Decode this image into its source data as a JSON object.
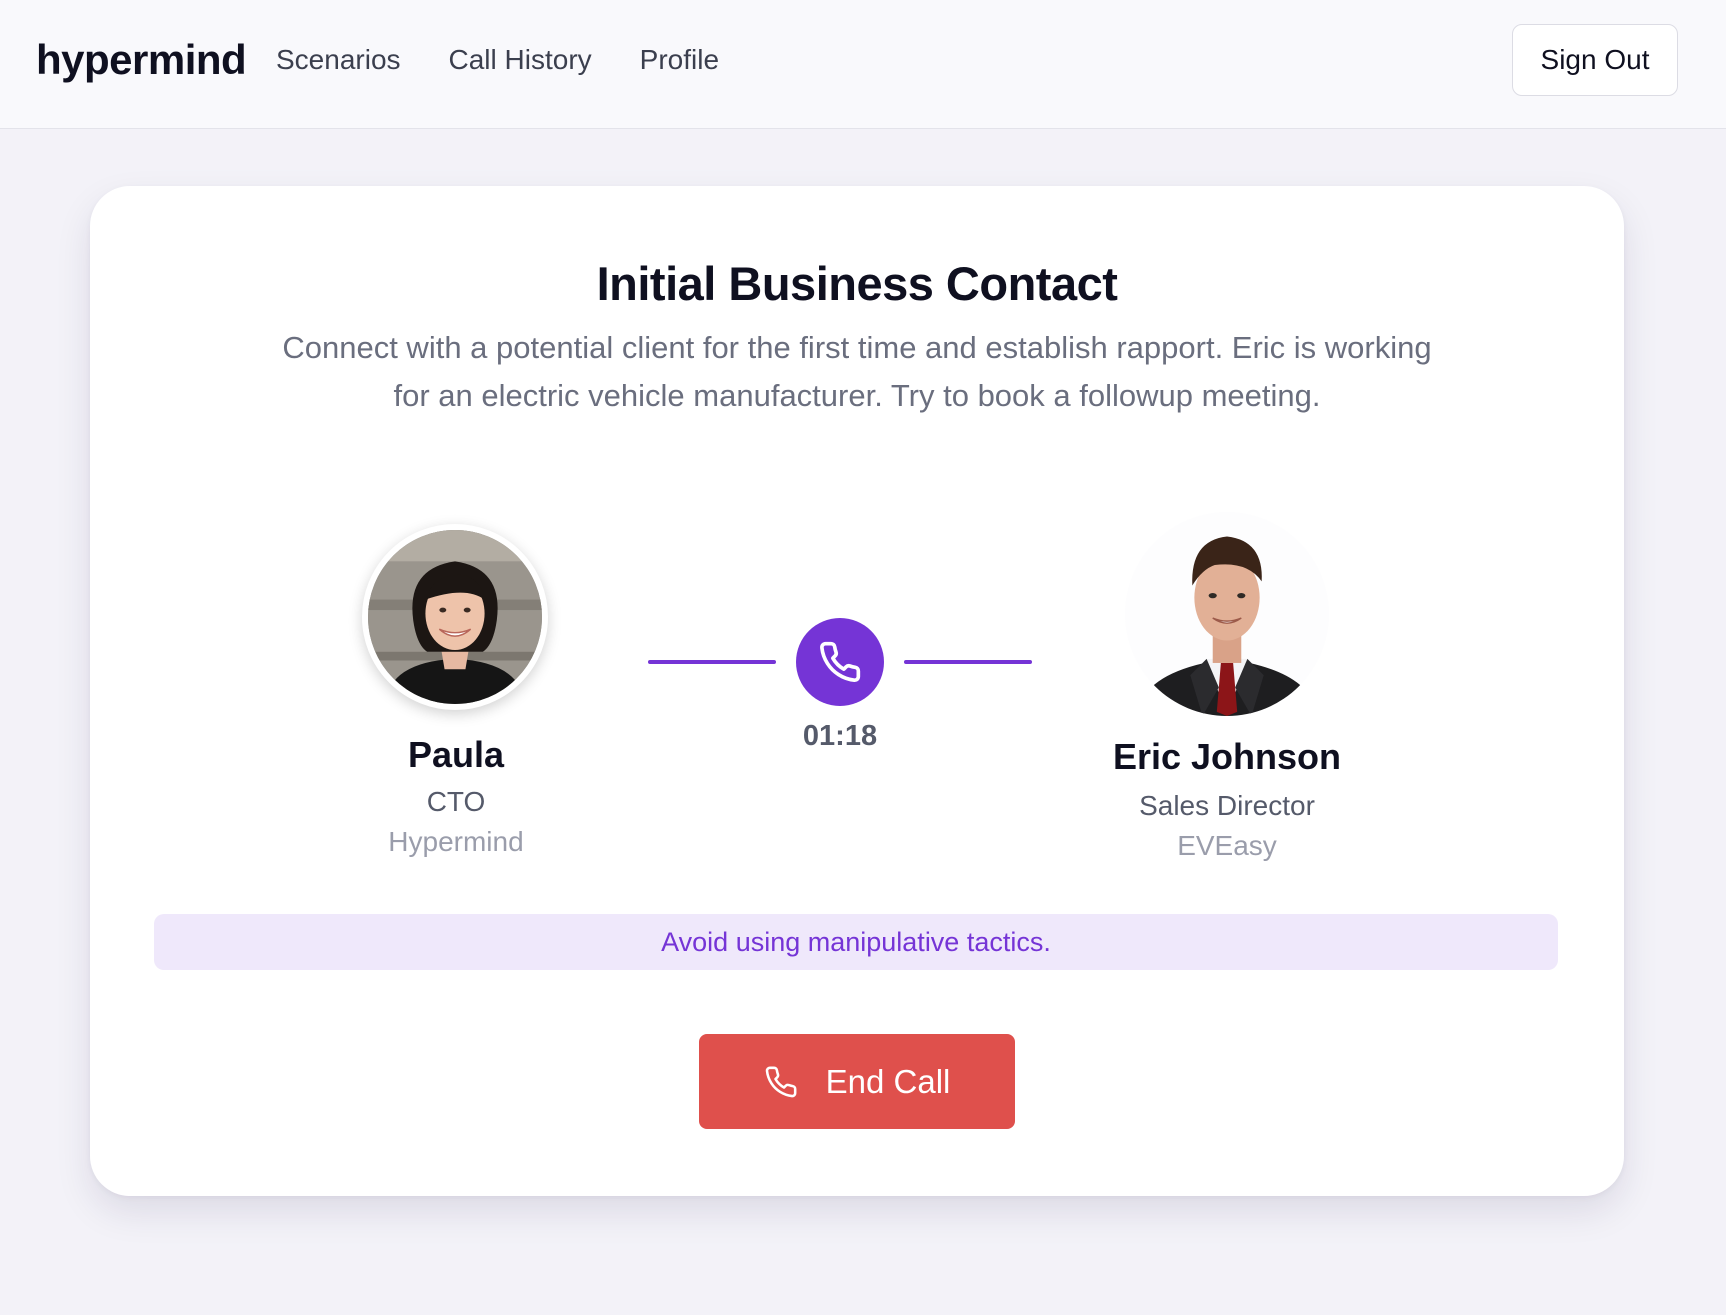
{
  "header": {
    "brand": "hypermind",
    "nav": [
      {
        "label": "Scenarios"
      },
      {
        "label": "Call History"
      },
      {
        "label": "Profile"
      }
    ],
    "sign_out_label": "Sign Out"
  },
  "scenario": {
    "title": "Initial Business Contact",
    "description": "Connect with a potential client for the first time and establish rapport. Eric is working for an electric vehicle manufacturer. Try to book a followup meeting."
  },
  "caller": {
    "name": "Paula",
    "role": "CTO",
    "company": "Hypermind"
  },
  "callee": {
    "name": "Eric Johnson",
    "role": "Sales Director",
    "company": "EVEasy"
  },
  "call": {
    "timer": "01:18",
    "status_icon": "phone-icon"
  },
  "notice": {
    "text": "Avoid using manipulative tactics."
  },
  "actions": {
    "end_call_label": "End Call",
    "end_call_icon": "phone-icon"
  },
  "colors": {
    "accent": "#7534d6",
    "notice_bg": "#efe8fb",
    "danger": "#df504c"
  }
}
